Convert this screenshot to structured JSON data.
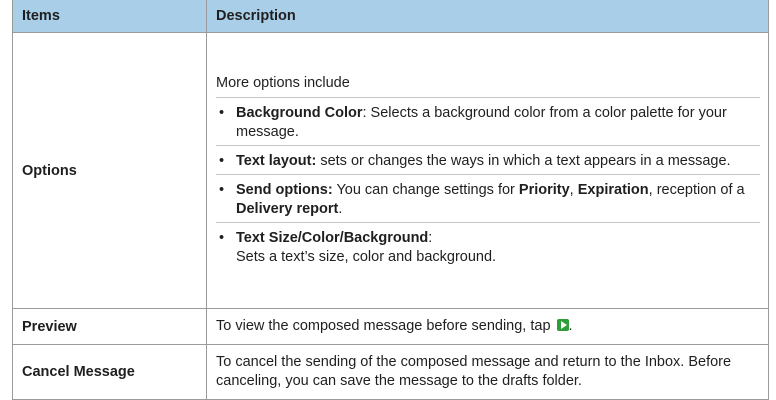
{
  "header": {
    "items": "Items",
    "description": "Description"
  },
  "rows": [
    {
      "item": "Options",
      "intro": "More options include",
      "bullets": [
        {
          "b1": "Background Color",
          "t1": ": Selects a background color from a color palette for your message."
        },
        {
          "b1": "Text layout:",
          "t1": " sets or changes the ways in which a text appears in a message."
        },
        {
          "b1": "Send options:",
          "t1": " You can change settings for ",
          "b2": "Priority",
          "t2": ", ",
          "b3": "Expiration",
          "t3": ", reception of a ",
          "b4": "Delivery report",
          "t4": "."
        },
        {
          "b1": "Text Size/Color/Background",
          "t1": ":",
          "t2": "Sets a text’s size, color and background."
        }
      ]
    },
    {
      "item": "Preview",
      "text": "To view the composed message before sending, tap",
      "suffix": ".",
      "icon": "play-icon"
    },
    {
      "item": "Cancel Message",
      "text": "To cancel the sending of the composed message and return to the Inbox. Before canceling, you can save the message to the drafts folder."
    }
  ],
  "colors": {
    "header_bg": "#a9cfe8",
    "border": "#9a9a9a",
    "icon_green": "#2f9e3a"
  }
}
